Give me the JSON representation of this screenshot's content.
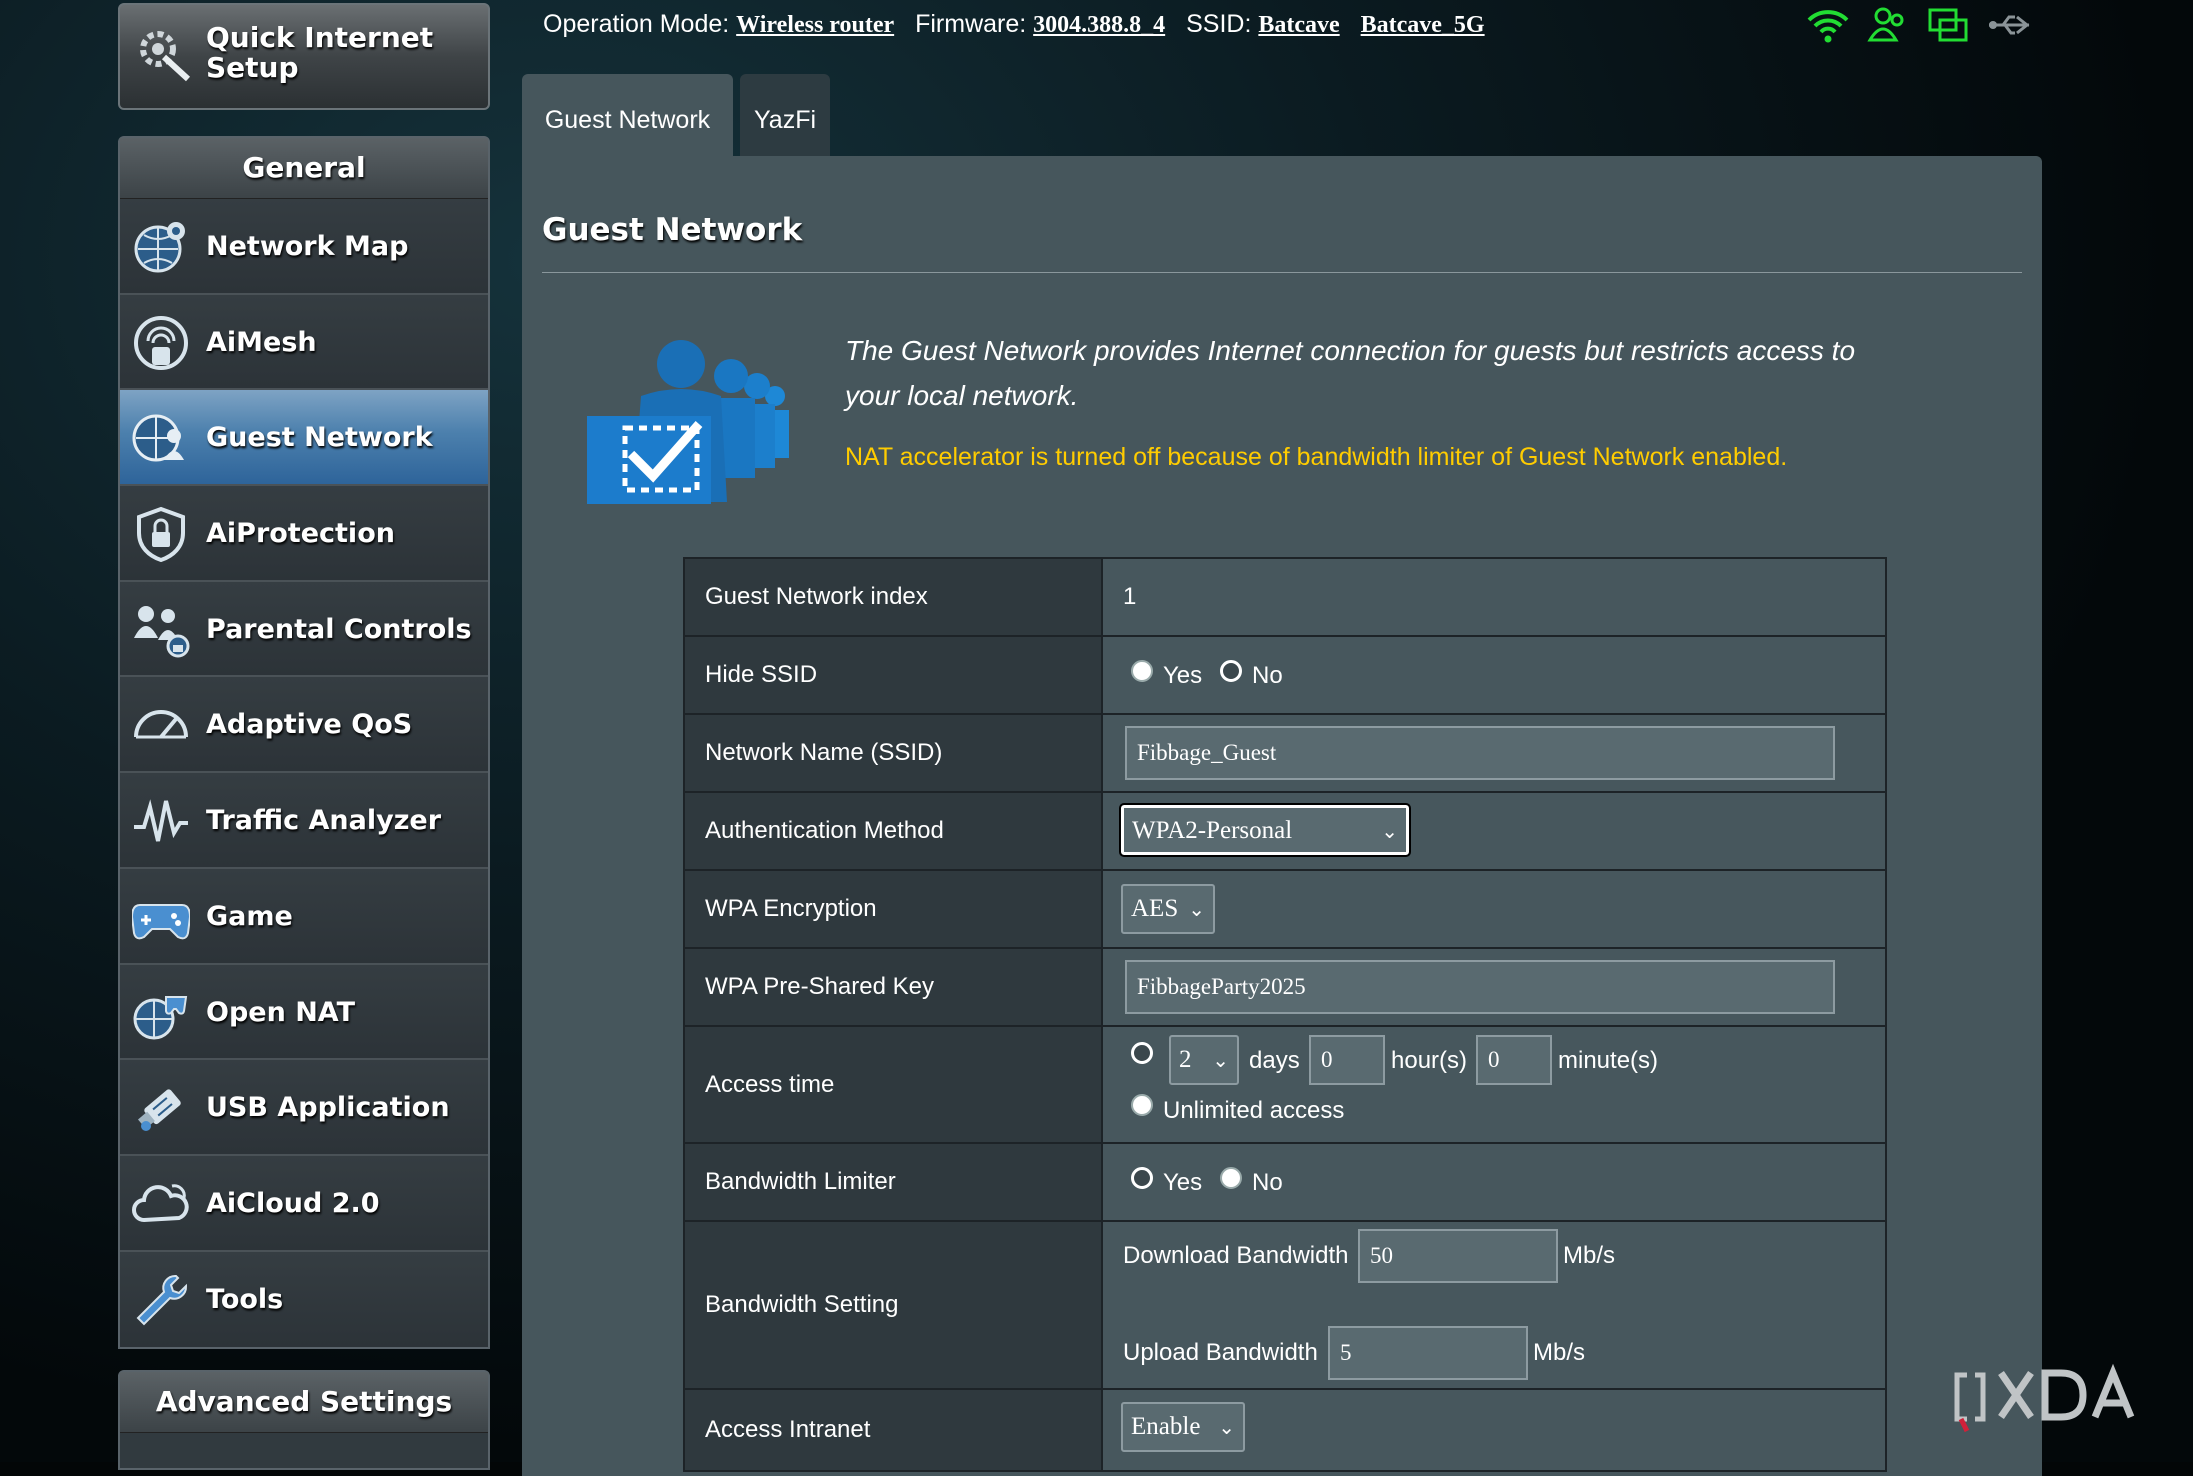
{
  "sidebar": {
    "quick_setup": "Quick Internet Setup",
    "general_header": "General",
    "items": [
      {
        "label": "Network Map",
        "icon": "globe-map-icon"
      },
      {
        "label": "AiMesh",
        "icon": "aimesh-icon"
      },
      {
        "label": "Guest Network",
        "icon": "guest-network-icon",
        "active": true
      },
      {
        "label": "AiProtection",
        "icon": "lock-shield-icon"
      },
      {
        "label": "Parental Controls",
        "icon": "family-icon"
      },
      {
        "label": "Adaptive QoS",
        "icon": "gauge-icon"
      },
      {
        "label": "Traffic Analyzer",
        "icon": "waveform-icon"
      },
      {
        "label": "Game",
        "icon": "gamepad-icon"
      },
      {
        "label": "Open NAT",
        "icon": "open-nat-icon"
      },
      {
        "label": "USB Application",
        "icon": "usb-icon"
      },
      {
        "label": "AiCloud 2.0",
        "icon": "cloud-icon"
      },
      {
        "label": "Tools",
        "icon": "wrench-icon"
      }
    ],
    "advanced_header": "Advanced Settings"
  },
  "status": {
    "op_mode_label": "Operation Mode:",
    "op_mode_value": "Wireless router",
    "firmware_label": "Firmware:",
    "firmware_value": "3004.388.8_4",
    "ssid_label": "SSID:",
    "ssid_1": "Batcave",
    "ssid_2": "Batcave_5G"
  },
  "tabs": [
    {
      "label": "Guest Network",
      "active": true
    },
    {
      "label": "YazFi",
      "active": false
    }
  ],
  "main": {
    "title": "Guest Network",
    "description": "The Guest Network provides Internet connection for guests but restricts access to your local network.",
    "warning": "NAT accelerator is turned off because of bandwidth limiter of Guest Network enabled."
  },
  "form": {
    "index_label": "Guest Network index",
    "index_value": "1",
    "hide_ssid_label": "Hide SSID",
    "yes": "Yes",
    "no": "No",
    "ssid_label": "Network Name (SSID)",
    "ssid_value": "Fibbage_Guest",
    "auth_label": "Authentication Method",
    "auth_value": "WPA2-Personal",
    "enc_label": "WPA Encryption",
    "enc_value": "AES",
    "psk_label": "WPA Pre-Shared Key",
    "psk_value": "FibbageParty2025",
    "access_time_label": "Access time",
    "days_value": "2",
    "days_unit": "days",
    "hours_value": "0",
    "hours_unit": "hour(s)",
    "minutes_value": "0",
    "minutes_unit": "minute(s)",
    "unlimited_label": "Unlimited access",
    "bw_limiter_label": "Bandwidth Limiter",
    "bw_setting_label": "Bandwidth Setting",
    "download_label": "Download Bandwidth",
    "download_value": "50",
    "upload_label": "Upload Bandwidth",
    "upload_value": "5",
    "unit_mbs": "Mb/s",
    "intranet_label": "Access Intranet",
    "intranet_value": "Enable"
  },
  "watermark": "XDA",
  "colors": {
    "accent_active": "#4c80ad",
    "warning_text": "#ffcc00",
    "status_green": "#22dd33"
  }
}
